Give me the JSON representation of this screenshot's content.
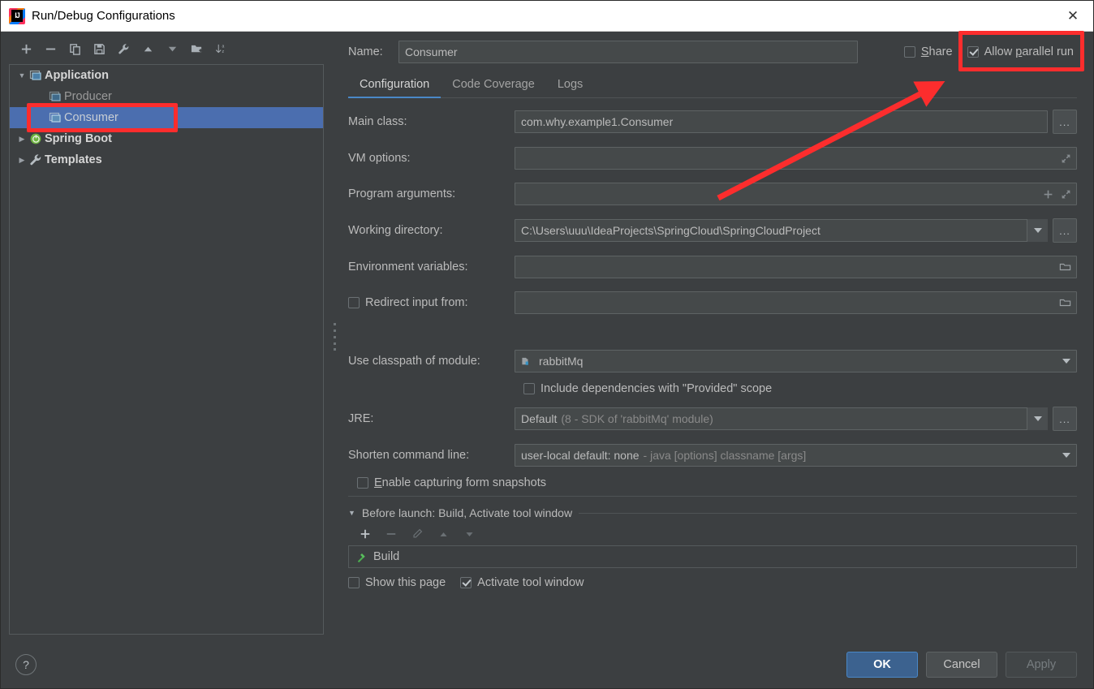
{
  "window": {
    "title": "Run/Debug Configurations",
    "app_icon": "intellij-idea-icon",
    "close_icon": "✕"
  },
  "sidebar": {
    "toolbar": [
      {
        "name": "add-configuration-button",
        "icon": "plus-icon"
      },
      {
        "name": "remove-configuration-button",
        "icon": "minus-icon"
      },
      {
        "name": "copy-configuration-button",
        "icon": "copy-icon"
      },
      {
        "name": "save-configuration-button",
        "icon": "save-icon"
      },
      {
        "name": "edit-templates-button",
        "icon": "wrench-icon"
      },
      {
        "name": "move-up-button",
        "icon": "arrow-up-icon"
      },
      {
        "name": "move-down-button",
        "icon": "arrow-down-icon"
      },
      {
        "name": "new-folder-button",
        "icon": "folder-add-icon"
      },
      {
        "name": "sort-alphabetically-button",
        "icon": "sort-az-icon"
      }
    ],
    "tree": [
      {
        "label": "Application",
        "type": "group",
        "expanded": true,
        "icon": "application-icon",
        "arrow": "▼"
      },
      {
        "label": "Producer",
        "type": "child",
        "icon": "application-icon",
        "selected": false
      },
      {
        "label": "Consumer",
        "type": "child",
        "icon": "application-icon",
        "selected": true
      },
      {
        "label": "Spring Boot",
        "type": "group",
        "expanded": false,
        "icon": "spring-boot-icon",
        "arrow": "▶"
      },
      {
        "label": "Templates",
        "type": "group",
        "expanded": false,
        "icon": "wrench-icon",
        "arrow": "▶"
      }
    ]
  },
  "header": {
    "name_label": "Name:",
    "name_value": "Consumer",
    "share_label": "Share",
    "share_checked": false,
    "allow_parallel_label": "Allow parallel run",
    "allow_parallel_checked": true
  },
  "tabs": [
    {
      "label": "Configuration",
      "active": true
    },
    {
      "label": "Code Coverage",
      "active": false
    },
    {
      "label": "Logs",
      "active": false
    }
  ],
  "form": {
    "main_class": {
      "label": "Main class:",
      "value": "com.why.example1.Consumer",
      "browse": "..."
    },
    "vm_options": {
      "label": "VM options:",
      "value": "",
      "expand_icon": "expand-icon"
    },
    "program_arguments": {
      "label": "Program arguments:",
      "value": "",
      "insert_icon": "plus-icon",
      "expand_icon": "expand-icon"
    },
    "working_directory": {
      "label": "Working directory:",
      "value": "C:\\Users\\uuu\\IdeaProjects\\SpringCloud\\SpringCloudProject",
      "browse": "..."
    },
    "environment_variables": {
      "label": "Environment variables:",
      "value": "",
      "browse_icon": "folder-icon"
    },
    "redirect_input": {
      "label": "Redirect input from:",
      "value": "",
      "checked": false,
      "browse_icon": "folder-icon"
    },
    "classpath_module": {
      "label": "Use classpath of module:",
      "value": "rabbitMq",
      "icon": "module-icon"
    },
    "include_provided": {
      "label": "Include dependencies with \"Provided\" scope",
      "checked": false
    },
    "jre": {
      "label": "JRE:",
      "value": "Default",
      "value_detail": "(8 - SDK of 'rabbitMq' module)",
      "browse": "..."
    },
    "shorten_command_line": {
      "label": "Shorten command line:",
      "value": "user-local default: none",
      "value_detail": "- java [options] classname [args]"
    },
    "enable_snapshots": {
      "label": "Enable capturing form snapshots",
      "checked": false
    }
  },
  "before_launch": {
    "header": "Before launch: Build, Activate tool window",
    "toolbar": [
      {
        "name": "add-task-button",
        "icon": "plus-icon",
        "enabled": true
      },
      {
        "name": "remove-task-button",
        "icon": "minus-icon",
        "enabled": false
      },
      {
        "name": "edit-task-button",
        "icon": "pencil-icon",
        "enabled": false
      },
      {
        "name": "move-task-up-button",
        "icon": "arrow-up-icon",
        "enabled": false
      },
      {
        "name": "move-task-down-button",
        "icon": "arrow-down-icon",
        "enabled": false
      }
    ],
    "items": [
      {
        "label": "Build",
        "icon": "build-hammer-icon"
      }
    ],
    "show_page_label": "Show this page",
    "show_page_checked": false,
    "activate_tool_window_label": "Activate tool window",
    "activate_tool_window_checked": true
  },
  "footer": {
    "help_label": "?",
    "ok_label": "OK",
    "cancel_label": "Cancel",
    "apply_label": "Apply",
    "apply_enabled": false
  },
  "annotations": {
    "color": "#fc2d2d",
    "boxes": [
      "consumer-tree-item",
      "allow-parallel-run-checkbox"
    ],
    "arrow": "points-to-allow-parallel-run"
  }
}
